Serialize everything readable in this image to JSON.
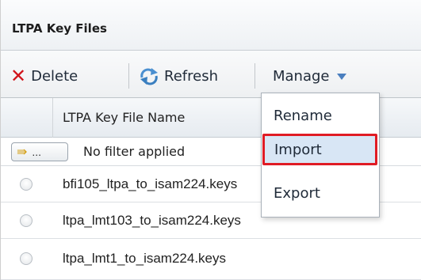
{
  "panel": {
    "title": "LTPA Key Files"
  },
  "toolbar": {
    "delete_label": "Delete",
    "refresh_label": "Refresh",
    "manage_label": "Manage"
  },
  "grid": {
    "column_name": "LTPA Key File Name",
    "filter_button": "...",
    "filter_text": "No filter applied",
    "rows": [
      {
        "name": "bfi105_ltpa_to_isam224.keys"
      },
      {
        "name": "ltpa_lmt103_to_isam224.keys"
      },
      {
        "name": "ltpa_lmt1_to_isam224.keys"
      }
    ]
  },
  "manage_menu": {
    "items": [
      {
        "label": "Rename"
      },
      {
        "label": "Import",
        "highlighted": true
      },
      {
        "label": "Export"
      }
    ],
    "highlight_color": "#e01b24"
  }
}
